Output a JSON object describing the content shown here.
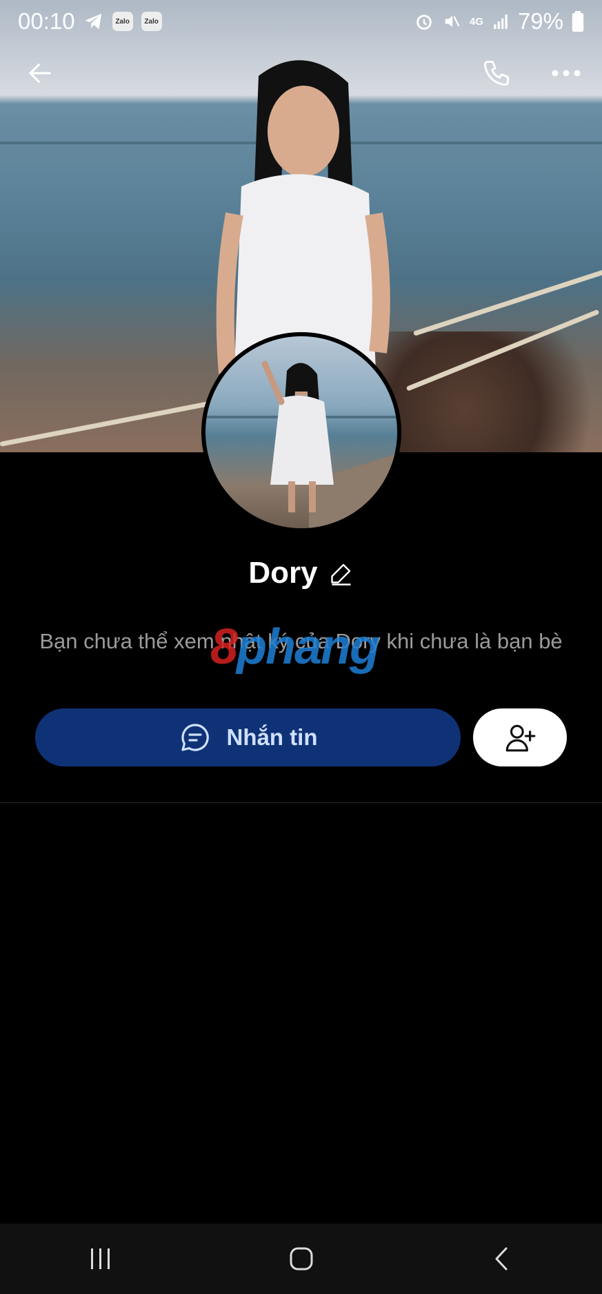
{
  "status_bar": {
    "time": "00:10",
    "app_chips": [
      "Zalo",
      "Zalo"
    ],
    "network": "4G",
    "battery": "79%"
  },
  "profile": {
    "name": "Dory",
    "notice": "Bạn chưa thể xem nhật ký của Dory khi chưa là bạn bè"
  },
  "watermark": {
    "text_a": "8",
    "text_b": "phang"
  },
  "actions": {
    "message_label": "Nhắn tin"
  },
  "colors": {
    "background": "#000000",
    "message_button": "#0f3277",
    "message_label": "#cfe0ff",
    "notice_text": "#9b9b9b"
  },
  "icons": {
    "back": "arrow-left-icon",
    "call": "phone-icon",
    "more": "more-dots-icon",
    "edit": "pencil-icon",
    "message": "chat-bubble-icon",
    "add_friend": "add-user-icon"
  }
}
